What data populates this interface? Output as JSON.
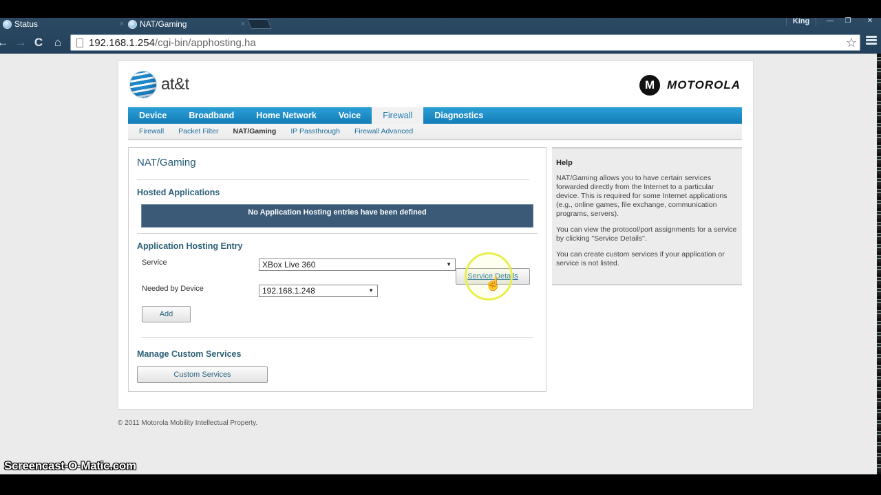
{
  "browser": {
    "tabs": [
      {
        "label": "Status",
        "icon": "globe-favicon",
        "active": false
      },
      {
        "label": "NAT/Gaming",
        "icon": "globe-favicon",
        "active": true
      }
    ],
    "close_glyph": "×",
    "user_badge": "King",
    "window_controls": {
      "minimize": "—",
      "restore": "❐",
      "close": "✕"
    },
    "nav": {
      "back": "←",
      "forward": "→",
      "reload": "C",
      "home": "⌂"
    },
    "url_host": "192.168.1.254",
    "url_path": "/cgi-bin/apphosting.ha",
    "star_glyph": "☆"
  },
  "header": {
    "att_logo_text": "at&t",
    "motorola_emblem": "M",
    "motorola_text": "MOTOROLA"
  },
  "main_nav": [
    {
      "label": "Device",
      "active": false
    },
    {
      "label": "Broadband",
      "active": false
    },
    {
      "label": "Home Network",
      "active": false
    },
    {
      "label": "Voice",
      "active": false
    },
    {
      "label": "Firewall",
      "active": true
    },
    {
      "label": "Diagnostics",
      "active": false
    }
  ],
  "sub_nav": [
    {
      "label": "Firewall",
      "active": false
    },
    {
      "label": "Packet Filter",
      "active": false
    },
    {
      "label": "NAT/Gaming",
      "active": true
    },
    {
      "label": "IP Passthrough",
      "active": false
    },
    {
      "label": "Firewall Advanced",
      "active": false
    }
  ],
  "content": {
    "title": "NAT/Gaming",
    "hosted_apps_heading": "Hosted Applications",
    "empty_message": "No Application Hosting entries have been defined",
    "entry_heading": "Application Hosting Entry",
    "service_label": "Service",
    "service_value": "XBox Live 360",
    "device_label": "Needed by Device",
    "device_value": "192.168.1.248",
    "service_details_button": "Service Details",
    "add_button": "Add",
    "custom_heading": "Manage Custom Services",
    "custom_button": "Custom Services",
    "select_arrow": "▼"
  },
  "help": {
    "title": "Help",
    "paragraphs": [
      "NAT/Gaming allows you to have certain services forwarded directly from the Internet to a particular device. This is required for some Internet applications (e.g., online games, file exchange, communication programs, servers).",
      "You can view the protocol/port assignments for a service by clicking \"Service Details\".",
      "You can create custom services if your application or service is not listed."
    ]
  },
  "footer": "© 2011 Motorola Mobility Intellectual Property.",
  "watermark": "Screencast-O-Matic.com",
  "colors": {
    "nav_blue": "#1b8cc8",
    "banner_blue": "#3a5a78",
    "heading_teal": "#2c5f78",
    "highlight_yellow": "#e8ee4a"
  }
}
